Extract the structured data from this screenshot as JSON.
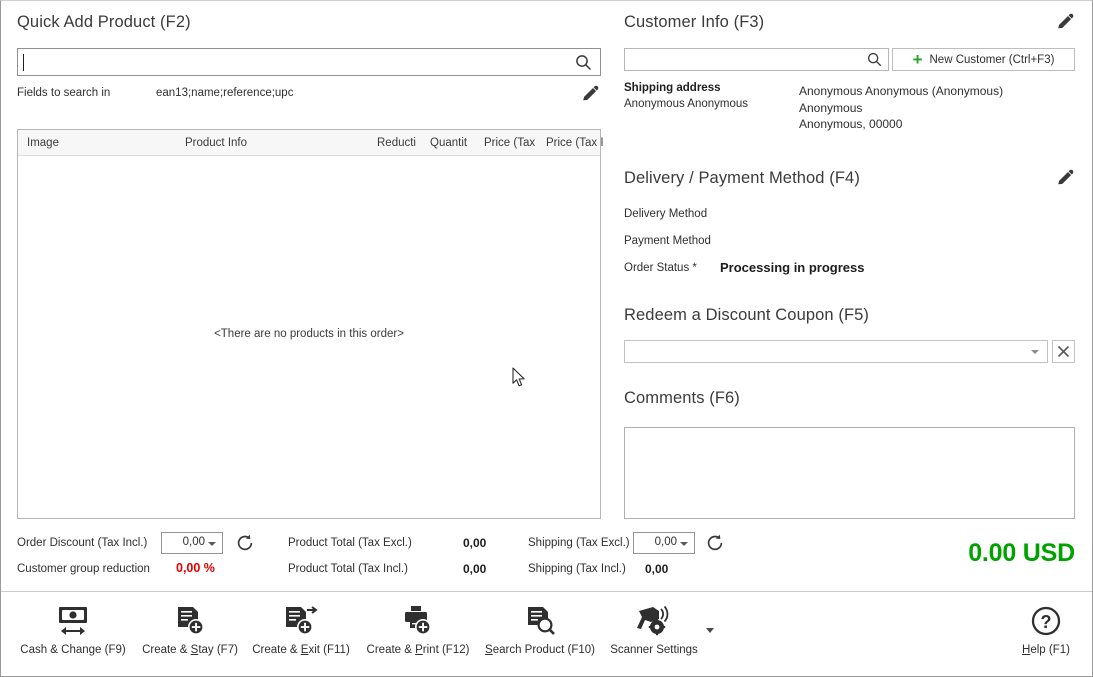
{
  "quick_add": {
    "title": "Quick Add Product (F2)",
    "search_value": "",
    "search_placeholder": "",
    "search_icon": "search-icon",
    "fields_label": "Fields to search in",
    "fields_value": "ean13;name;reference;upc",
    "edit_icon": "pencil-icon",
    "grid": {
      "columns": [
        "Image",
        "Product Info",
        "Reducti",
        "Quantit",
        "Price (Tax",
        "Price (Tax I"
      ],
      "rows": [],
      "empty_message": "<There are no products in this order>"
    }
  },
  "totals": {
    "order_discount_label": "Order Discount (Tax Incl.)",
    "order_discount_value": "0,00",
    "order_discount_refresh_icon": "refresh-icon",
    "customer_group_label": "Customer group reduction",
    "customer_group_value": "0,00 %",
    "product_total_excl_label": "Product Total (Tax Excl.)",
    "product_total_excl_value": "0,00",
    "product_total_incl_label": "Product Total (Tax Incl.)",
    "product_total_incl_value": "0,00",
    "shipping_excl_label": "Shipping (Tax Excl.)",
    "shipping_excl_value": "0,00",
    "shipping_refresh_icon": "refresh-icon",
    "shipping_incl_label": "Shipping (Tax Incl.)",
    "shipping_incl_value": "0,00",
    "grand_total": "0.00 USD",
    "grand_total_color": "#00a200",
    "discount_color": "#e00000"
  },
  "customer": {
    "title": "Customer Info (F3)",
    "edit_icon": "pencil-icon",
    "search_value": "",
    "search_icon": "search-icon",
    "new_customer_label": "New Customer (Ctrl+F3)",
    "new_customer_icon": "plus-icon",
    "new_customer_icon_color": "#27a327",
    "shipping_heading": "Shipping address",
    "shipping_name": "Anonymous Anonymous",
    "address_lines": [
      "Anonymous Anonymous (Anonymous)",
      "Anonymous",
      "Anonymous,  00000"
    ]
  },
  "delivery_payment": {
    "title": "Delivery / Payment Method (F4)",
    "edit_icon": "pencil-icon",
    "rows": [
      {
        "label": "Delivery Method",
        "value": ""
      },
      {
        "label": "Payment Method",
        "value": ""
      },
      {
        "label": "Order Status *",
        "value": "Processing in progress"
      }
    ]
  },
  "coupon": {
    "title": "Redeem a Discount Coupon (F5)",
    "value": "",
    "dropdown_icon": "chevron-down-icon",
    "clear_icon": "close-icon"
  },
  "comments": {
    "title": "Comments (F6)",
    "value": ""
  },
  "toolbar": {
    "items": [
      {
        "label": "Cash & Change (F9)",
        "icon": "cash-exchange-icon",
        "accel": ""
      },
      {
        "label": "Create & Stay (F7)",
        "icon": "document-add-icon",
        "accel": "S"
      },
      {
        "label": "Create & Exit (F11)",
        "icon": "document-add-exit-icon",
        "accel": "E"
      },
      {
        "label": "Create & Print (F12)",
        "icon": "document-print-add-icon",
        "accel": "P"
      },
      {
        "label": "Search Product (F10)",
        "icon": "document-search-icon",
        "accel": "S"
      },
      {
        "label": "Scanner Settings",
        "icon": "scanner-settings-icon",
        "accel": ""
      }
    ],
    "overflow_icon": "chevron-down-icon",
    "help_label": "Help (F1)",
    "help_icon": "help-circle-icon",
    "help_accel": "H"
  }
}
